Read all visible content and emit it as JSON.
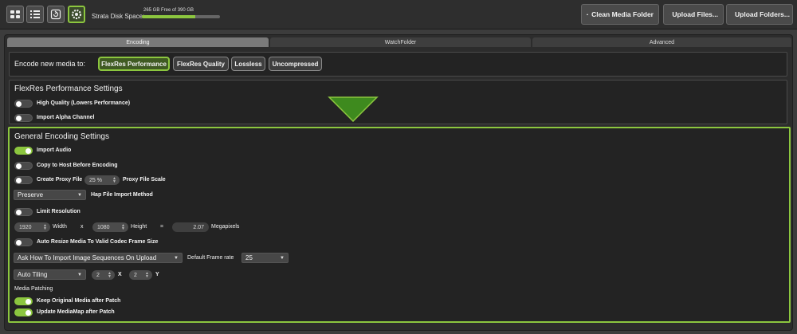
{
  "toolbar": {
    "disk_label": "Strata Disk Space:",
    "disk_info": "265 GB Free of 390 GB",
    "disk_free_fraction": 0.68,
    "clean_label": "Clean Media Folder",
    "upload_files_label": "Upload Files...",
    "upload_folders_label": "Upload Folders...",
    "icons": [
      "grid-view-icon",
      "list-view-icon",
      "refresh-icon",
      "settings-icon"
    ]
  },
  "tabs": [
    "Encoding",
    "WatchFolder",
    "Advanced"
  ],
  "encode": {
    "label": "Encode new media to:",
    "options": [
      "FlexRes Performance",
      "FlexRes Quality",
      "Lossless",
      "Uncompressed"
    ],
    "selected": "FlexRes Performance"
  },
  "flexres": {
    "title": "FlexRes Performance Settings",
    "high_quality": "High Quality (Lowers Performance)",
    "alpha": "Import Alpha Channel"
  },
  "general": {
    "title": "General Encoding Settings",
    "import_audio": "Import Audio",
    "copy_to_host": "Copy to Host Before Encoding",
    "create_proxy": "Create Proxy File",
    "proxy_scale_value": "25 %",
    "proxy_scale_label": "Proxy File Scale",
    "hap_method": "Preserve",
    "hap_label": "Hap File Import Method",
    "limit_resolution": "Limit Resolution",
    "width_value": "1920",
    "width_label": "Width",
    "x_sep": "x",
    "height_value": "1080",
    "height_label": "Height",
    "eq_sep": "=",
    "megapixels_value": "2.07",
    "megapixels_label": "Megapixels",
    "auto_resize": "Auto Resize Media To Valid Codec Frame Size",
    "image_seq": "Ask How To Import Image Sequences On Upload",
    "frame_rate_label": "Default Frame rate",
    "frame_rate_value": "25",
    "tiling": "Auto Tiling",
    "tile_x": "2",
    "tile_x_label": "X",
    "tile_y": "2",
    "tile_y_label": "Y",
    "media_patching": "Media Patching",
    "keep_original": "Keep Original Media after Patch",
    "update_mediamap": "Update MediaMap after Patch"
  },
  "colors": {
    "accent": "#8cc63f",
    "panel": "#232323",
    "background": "#3c3c3c"
  }
}
